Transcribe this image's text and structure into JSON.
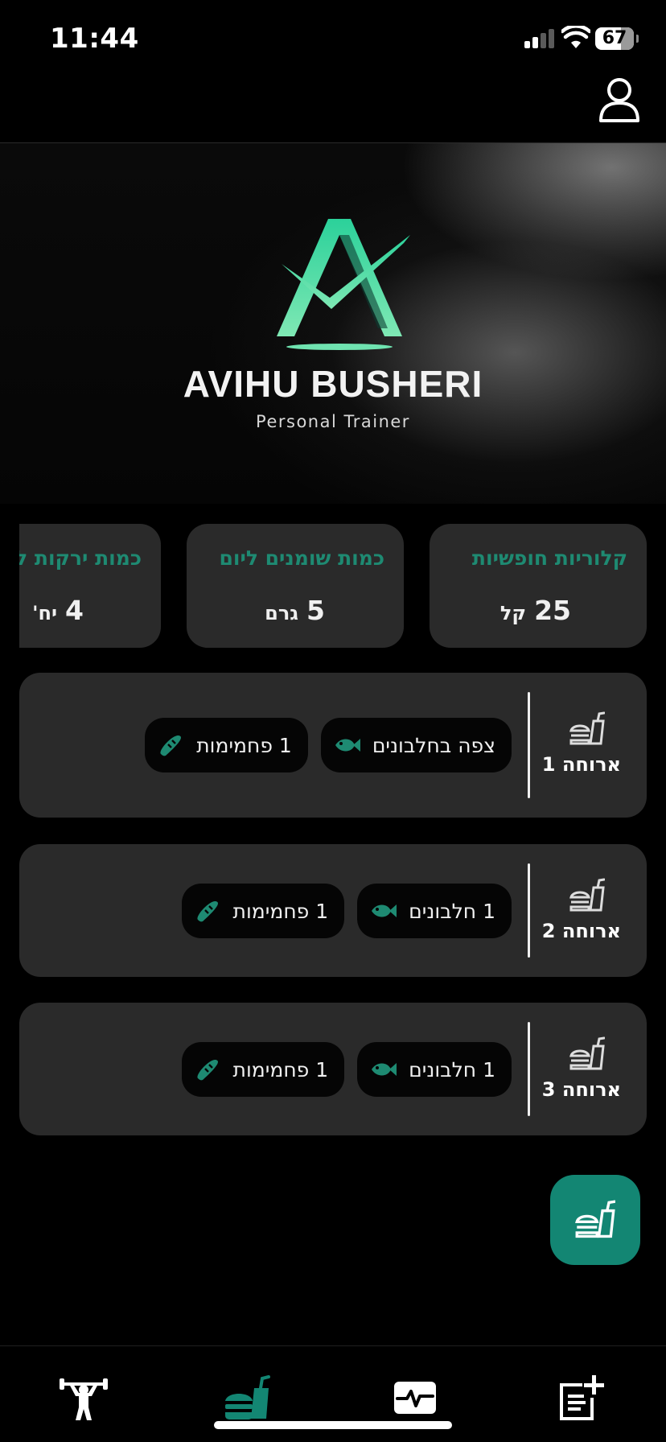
{
  "status_bar": {
    "time": "11:44",
    "battery": "67"
  },
  "brand": {
    "name": "AVIHU BUSHERI",
    "subtitle": "Personal Trainer"
  },
  "stats": [
    {
      "title": "קלוריות חופשיות",
      "value": "25",
      "unit": "קל"
    },
    {
      "title": "כמות שומנים ליום",
      "value": "5",
      "unit": "גרם"
    },
    {
      "title": "כמות ירקות ליום",
      "value": "4",
      "unit": "יח'"
    }
  ],
  "meals": [
    {
      "label": "ארוחה 1",
      "items": [
        {
          "icon": "fish-icon",
          "text": "צפה בחלבונים"
        },
        {
          "icon": "bread-icon",
          "text": "1 פחמימות"
        }
      ]
    },
    {
      "label": "ארוחה 2",
      "items": [
        {
          "icon": "fish-icon",
          "text": "1 חלבונים"
        },
        {
          "icon": "bread-icon",
          "text": "1 פחמימות"
        }
      ]
    },
    {
      "label": "ארוחה 3",
      "items": [
        {
          "icon": "fish-icon",
          "text": "1 חלבונים"
        },
        {
          "icon": "bread-icon",
          "text": "1 פחמימות"
        }
      ]
    }
  ],
  "nav": {
    "items": [
      {
        "icon": "weightlifter-icon",
        "active": false
      },
      {
        "icon": "food-drink-icon",
        "active": true
      },
      {
        "icon": "activity-pulse-icon",
        "active": false
      },
      {
        "icon": "add-note-icon",
        "active": false
      }
    ]
  },
  "colors": {
    "accent": "#138673",
    "accent_text": "#1e8a72",
    "card": "#2a2a2a",
    "chip": "#050505",
    "background": "#000000"
  }
}
